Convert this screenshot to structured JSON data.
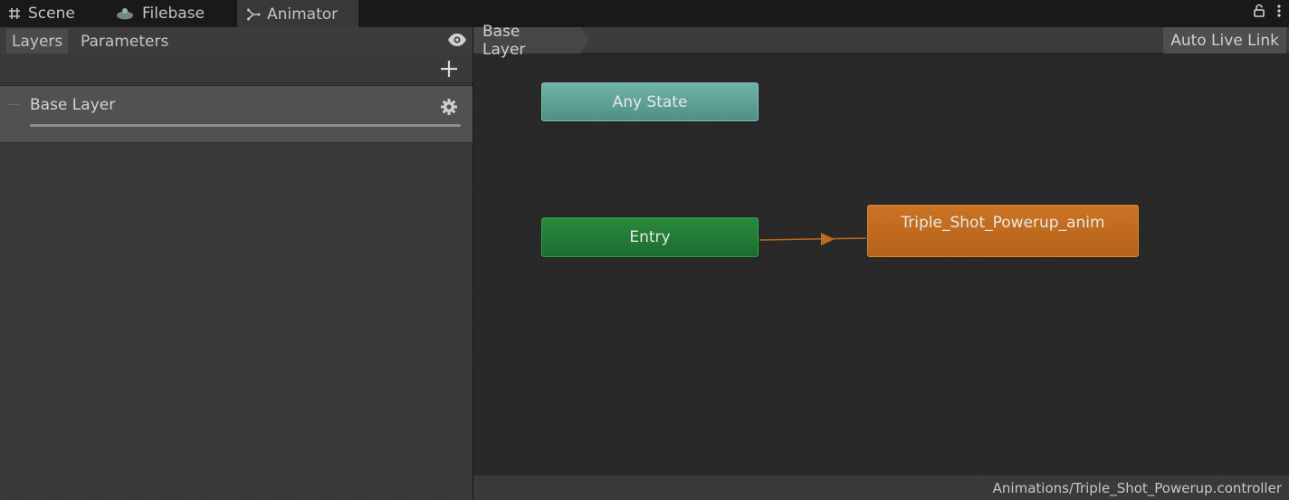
{
  "window_tabs": [
    {
      "label": "Scene",
      "icon": "grid-hash-icon"
    },
    {
      "label": "Filebase",
      "icon": "filebase-logo-icon"
    },
    {
      "label": "Animator",
      "icon": "animator-icon",
      "active": true
    }
  ],
  "left_panel": {
    "tabs": {
      "layers": "Layers",
      "parameters": "Parameters"
    },
    "selected_tab": "Layers",
    "layers": [
      {
        "name": "Base Layer",
        "weight": 1.0
      }
    ]
  },
  "graph": {
    "breadcrumb": "Base Layer",
    "auto_live_link": "Auto Live Link",
    "nodes": {
      "any_state": "Any State",
      "entry": "Entry",
      "default_state": "Triple_Shot_Powerup_anim"
    },
    "status_path": "Animations/Triple_Shot_Powerup.controller"
  },
  "colors": {
    "any_state": "#5fa398",
    "entry": "#227d36",
    "default_state": "#c16b1f",
    "transition": "#c16b1f"
  }
}
